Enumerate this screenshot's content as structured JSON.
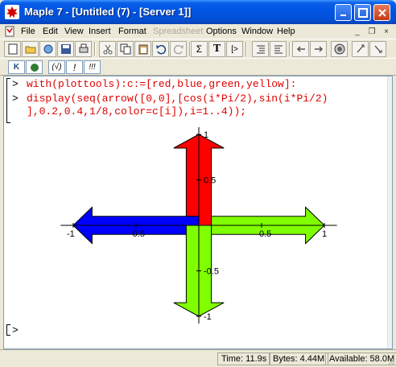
{
  "window": {
    "title": "Maple 7 - [Untitled (7) - [Server 1]]",
    "controls": {
      "minimize": "_",
      "maximize": "□",
      "close": "×"
    }
  },
  "menubar": {
    "items": [
      {
        "label": "File",
        "enabled": true
      },
      {
        "label": "Edit",
        "enabled": true
      },
      {
        "label": "View",
        "enabled": true
      },
      {
        "label": "Insert",
        "enabled": true
      },
      {
        "label": "Format",
        "enabled": true
      },
      {
        "label": "Spreadsheet",
        "enabled": false
      },
      {
        "label": "Options",
        "enabled": true
      },
      {
        "label": "Window",
        "enabled": true
      },
      {
        "label": "Help",
        "enabled": true
      }
    ],
    "mdi": {
      "minimize": "_",
      "restore": "❐",
      "close": "×"
    }
  },
  "toolbar": {
    "sigma": "Σ",
    "text_mode": "T",
    "prompt_insert": "[>"
  },
  "context_bar": {
    "bold_k": "K",
    "eval_label": "(√)",
    "exec_label": "!",
    "exec_all_label": "!!!"
  },
  "worksheet": {
    "prompt": ">",
    "line1": "with(plottools):c:=[red,blue,green,yellow]:",
    "line2a": "display(seq(arrow([0,0],[cos(i*Pi/2),sin(i*Pi/2)",
    "line2b": "],0.2,0.4,1/8,color=c[i]),i=1..4));",
    "empty_prompt": ">"
  },
  "chart_data": {
    "type": "arrow-plot",
    "xlim": [
      -1,
      1
    ],
    "ylim": [
      -1,
      1
    ],
    "x_ticks": [
      "-1",
      "-0.5",
      "0.5",
      "1"
    ],
    "y_ticks": [
      "1",
      "0.5",
      "-0.5",
      "-1"
    ],
    "arrows": [
      {
        "from": [
          0,
          0
        ],
        "to": [
          1,
          0
        ],
        "width": 0.2,
        "head_width": 0.4,
        "head_ratio": 0.125,
        "color": "#80ff00"
      },
      {
        "from": [
          0,
          0
        ],
        "to": [
          0,
          1
        ],
        "width": 0.2,
        "head_width": 0.4,
        "head_ratio": 0.125,
        "color": "#ff0000"
      },
      {
        "from": [
          0,
          0
        ],
        "to": [
          -1,
          0
        ],
        "width": 0.2,
        "head_width": 0.4,
        "head_ratio": 0.125,
        "color": "#0000ff"
      },
      {
        "from": [
          0,
          0
        ],
        "to": [
          0,
          -1
        ],
        "width": 0.2,
        "head_width": 0.4,
        "head_ratio": 0.125,
        "color": "#80ff00"
      }
    ]
  },
  "statusbar": {
    "time": "Time: 11.9s",
    "bytes": "Bytes: 4.44M",
    "available": "Available: 58.0M"
  }
}
